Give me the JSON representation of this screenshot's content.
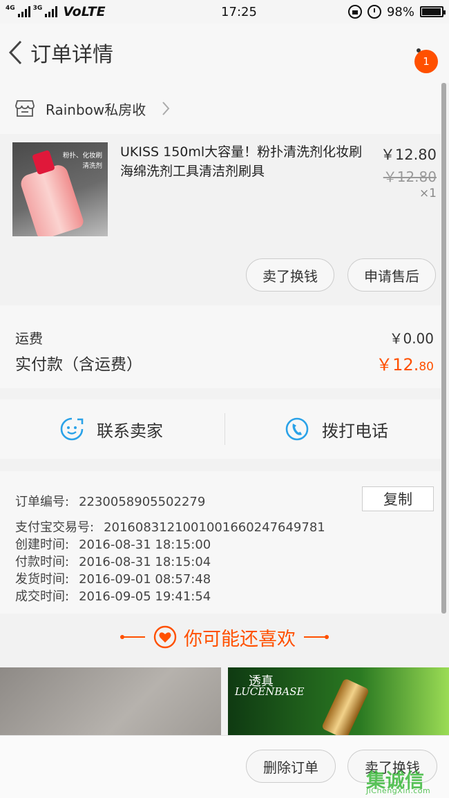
{
  "status_bar": {
    "network_1": "4G",
    "network_2": "3G",
    "volte": "VoLTE",
    "time": "17:25",
    "battery": "98%",
    "battery_level": 0.98
  },
  "header": {
    "title": "订单详情",
    "badge_count": "1"
  },
  "shop": {
    "name": "Rainbow私房收"
  },
  "product": {
    "title": "UKISS 150ml大容量！粉扑清洗剂化妆刷海绵洗剂工具清洁剂刷具",
    "price": "￥12.80",
    "original_price": "￥12.80",
    "quantity": "×1",
    "thumb_text": [
      "粉扑、化妆刷",
      "清洗剂"
    ]
  },
  "item_actions": {
    "sell": "卖了换钱",
    "after_sale": "申请售后"
  },
  "totals": {
    "shipping_label": "运费",
    "shipping_value": "￥0.00",
    "paid_label": "实付款（含运费）",
    "paid_main": "￥12.",
    "paid_cents": "80"
  },
  "contact": {
    "seller": "联系卖家",
    "phone": "拨打电话"
  },
  "order_info": {
    "order_no_label": "订单编号:",
    "order_no": "2230058905502279",
    "copy": "复制",
    "alipay_label": "支付宝交易号:",
    "alipay_no": "2016083121001001660247649781",
    "created_label": "创建时间:",
    "created": "2016-08-31  18:15:00",
    "paid_label": "付款时间:",
    "paid": "2016-08-31  18:15:04",
    "shipped_label": "发货时间:",
    "shipped": "2016-09-01  08:57:48",
    "done_label": "成交时间:",
    "done": "2016-09-05  19:41:54"
  },
  "recommend": {
    "title": "你可能还喜欢",
    "item2_brand_cn": "透真",
    "item2_brand_en": "LUCENBASE"
  },
  "bottom_bar": {
    "delete": "删除订单",
    "sell": "卖了换钱"
  },
  "watermark": {
    "main": "集诚信",
    "sub": "JiChengXin.com"
  },
  "colors": {
    "accent": "#ff5000",
    "icon_blue": "#2aa2e8"
  }
}
